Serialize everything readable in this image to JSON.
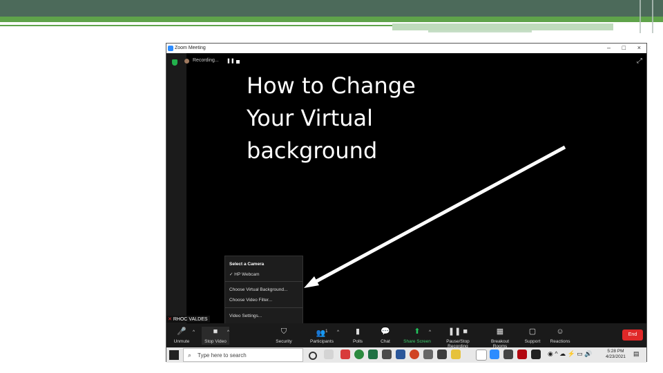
{
  "zoom_window": {
    "title": "Zoom Meeting",
    "window_controls": [
      "–",
      "□",
      "×"
    ],
    "recording_text": "Recording...",
    "recording_pause_icon": "pause-icon",
    "recording_stop_icon": "stop-icon"
  },
  "slide": {
    "title_lines": [
      "How to Change",
      "Your Virtual",
      "background"
    ],
    "colors": {
      "top_bar": "#4c6a5a",
      "green_line": "#5fa34a"
    }
  },
  "camera_menu": {
    "header": "Select a Camera",
    "items": [
      {
        "label": "HP Webcam",
        "checked": true
      },
      {
        "label": "Choose Virtual Background..."
      },
      {
        "label": "Choose Video Filter..."
      },
      {
        "label": "Video Settings..."
      }
    ]
  },
  "participant": {
    "name": "RHOC VALDES"
  },
  "toolbar": {
    "unmute": "Unmute",
    "stop_video": "Stop Video",
    "security": "Security",
    "participants": "Participants",
    "participants_count": "1",
    "polls": "Polls",
    "chat": "Chat",
    "share_screen": "Share Screen",
    "pause_stop_recording": "Pause/Stop Recording",
    "breakout_rooms": "Breakout Rooms",
    "support": "Support",
    "reactions": "Reactions",
    "end": "End"
  },
  "taskbar": {
    "search_placeholder": "Type here to search",
    "time": "5:28 PM",
    "date": "4/23/2021",
    "colors": {
      "accent": "#2d8cff",
      "end": "#e02828"
    }
  }
}
